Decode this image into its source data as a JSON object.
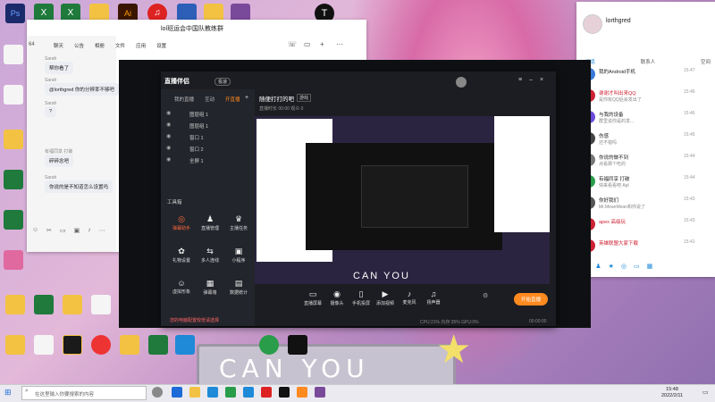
{
  "desktop": {
    "sign_text": "CAN YOU",
    "icons": [
      {
        "label": "Ps",
        "color": "#1a2a6a"
      },
      {
        "label": "X",
        "color": "#1f7a3c"
      },
      {
        "label": "Ai",
        "color": "#cc6a00"
      },
      {
        "label": "网易云",
        "color": "#d22"
      },
      {
        "label": "文档",
        "color": "#f3c243"
      }
    ]
  },
  "chat": {
    "title": "lol班运会中国队教练群",
    "tabs": [
      "聊天",
      "公告",
      "相册",
      "文件",
      "应用",
      "设置"
    ],
    "member_count": "64",
    "messages": [
      {
        "name": "Sarah",
        "text": "帮你看了"
      },
      {
        "name": "Sarah",
        "text": "@lorthgred 你的分辨率不够吧"
      },
      {
        "name": "Sarah",
        "text": "?"
      },
      {
        "name": "有福同享 打破",
        "text": "碎碎念吧"
      },
      {
        "name": "Sarah",
        "text": "你说的是不知道怎么设置吗"
      }
    ]
  },
  "qq": {
    "username": "lorthgred",
    "tabs": [
      "消息",
      "联系人",
      "空间"
    ],
    "items": [
      {
        "name": "我的Android手机",
        "msg": "",
        "time": "15:47",
        "color": "#3b7bd8"
      },
      {
        "name": "谢谢才叫出来QQ",
        "msg": "是你有QQ后会发出了",
        "time": "15:46",
        "color": "#c23"
      },
      {
        "name": "与我的设备",
        "msg": "群里说你是的发...",
        "time": "15:46",
        "color": "#6b4bd8"
      },
      {
        "name": "伤感",
        "msg": "还不错吗",
        "time": "15:45",
        "color": "#444"
      },
      {
        "name": "你说的做不到",
        "msg": "点看那个吃的",
        "time": "15:44",
        "color": "#777"
      },
      {
        "name": "有福同享 打破",
        "msg": "快来看看吧 Apl",
        "time": "15:44",
        "color": "#2a9d4a"
      },
      {
        "name": "你好我们",
        "msg": "Mr.MeanMean和你说了",
        "time": "15:43",
        "color": "#555"
      },
      {
        "name": "apex 高级玩",
        "msg": "",
        "time": "15:43",
        "color": "#c23"
      },
      {
        "name": "英雄联盟大家下载",
        "msg": "",
        "time": "15:41",
        "color": "#c23"
      }
    ]
  },
  "app": {
    "brand": "直播伴侣",
    "version": "极速",
    "nav": [
      "我的直播",
      "互动",
      "开直播"
    ],
    "stream_title": "随便打打的吧",
    "stream_tag": "游戏",
    "stream_info": "直播时长 00:00 观众 0",
    "layers": [
      {
        "label": "图层组 1"
      },
      {
        "label": "图层组 1"
      },
      {
        "label": "窗口 1"
      },
      {
        "label": "窗口 2"
      },
      {
        "label": "全屏 1"
      }
    ],
    "side_tools_header": "工具箱",
    "side_tools": [
      {
        "label": "弹幕助手",
        "glyph": "◎"
      },
      {
        "label": "直播管理",
        "glyph": "♟"
      },
      {
        "label": "主播任务",
        "glyph": "♛"
      },
      {
        "label": "礼物设置",
        "glyph": "✿"
      },
      {
        "label": "多人连线",
        "glyph": "⇆"
      },
      {
        "label": "小程序",
        "glyph": "▣"
      },
      {
        "label": "虚拟形象",
        "glyph": "☺"
      },
      {
        "label": "弹幕墙",
        "glyph": "▦"
      },
      {
        "label": "数据统计",
        "glyph": "▤"
      }
    ],
    "bottom_tools": [
      {
        "label": "直播屏幕",
        "glyph": "▭"
      },
      {
        "label": "摄像头",
        "glyph": "◉"
      },
      {
        "label": "手机投屏",
        "glyph": "▯"
      },
      {
        "label": "添加视频",
        "glyph": "▶"
      },
      {
        "label": "麦克风",
        "glyph": "♪"
      },
      {
        "label": "扬声器",
        "glyph": "♫"
      }
    ],
    "start_button": "开始直播",
    "notice": "您的电脑配置较低请选择",
    "stats": "CPU:21%  内存:35%  GPU:0%",
    "timer": "00:00:00",
    "preview_text": "CAN YOU"
  },
  "taskbar": {
    "search_placeholder": "在这里输入你要搜索的内容",
    "time": "15:48",
    "date": "2022/2/11"
  }
}
